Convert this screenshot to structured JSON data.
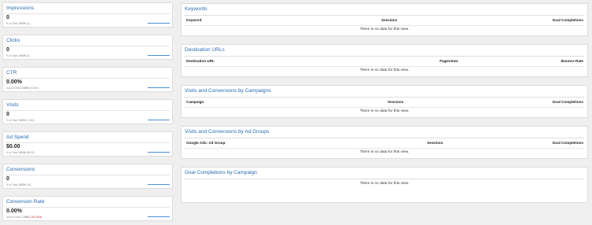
{
  "metrics": [
    {
      "title": "Impressions",
      "value": "0",
      "sub_label": "% of Total:",
      "sub_pct": "0.00%",
      "sub_extra": "(0)"
    },
    {
      "title": "Clicks",
      "value": "0",
      "sub_label": "% of Total:",
      "sub_pct": "0.00%",
      "sub_extra": "(0)"
    },
    {
      "title": "CTR",
      "value": "0.00%",
      "sub_label": "Avg for View:",
      "sub_pct": "0.00%",
      "sub_extra": "(0.00%)"
    },
    {
      "title": "Visits",
      "value": "0",
      "sub_label": "% of Total:",
      "sub_pct": "0.00%",
      "sub_extra": "(1,111)"
    },
    {
      "title": "Ad Spend",
      "value": "$0.00",
      "sub_label": "% of Total:",
      "sub_pct": "0.00%",
      "sub_extra": "($0.00)"
    },
    {
      "title": "Conversions",
      "value": "0",
      "sub_label": "% of Total:",
      "sub_pct": "0.00%",
      "sub_extra": "(14)"
    },
    {
      "title": "Conversion Rate",
      "value": "0.00%",
      "sub_label": "Avg for View:",
      "sub_pct": "1.26%",
      "sub_extra": "(-100.00%)"
    }
  ],
  "panels": [
    {
      "title": "Keywords",
      "columns": [
        "Keyword",
        "Sessions",
        "Goal Completions"
      ],
      "empty": "There is no data for this view."
    },
    {
      "title": "Destination URLs",
      "columns": [
        "Destination URL",
        "Pageviews",
        "Bounce Rate"
      ],
      "empty": "There is no data for this view."
    },
    {
      "title": "Visits and Conversions by Campaigns",
      "columns": [
        "Campaign",
        "Sessions",
        "Goal Completions"
      ],
      "empty": "There is no data for this view."
    },
    {
      "title": "Visits and Conversions by Ad Groups",
      "columns": [
        "Google Ads: Ad Group",
        "Sessions",
        "Goal Completions"
      ],
      "empty": "There is no data for this view."
    },
    {
      "title": "Goal Completions by Campaign",
      "columns": [],
      "empty": "There is no data for this view."
    }
  ],
  "colors": {
    "accent": "#2a6bb5",
    "sparkline": "#4a90d9",
    "negative": "#c0392b"
  }
}
